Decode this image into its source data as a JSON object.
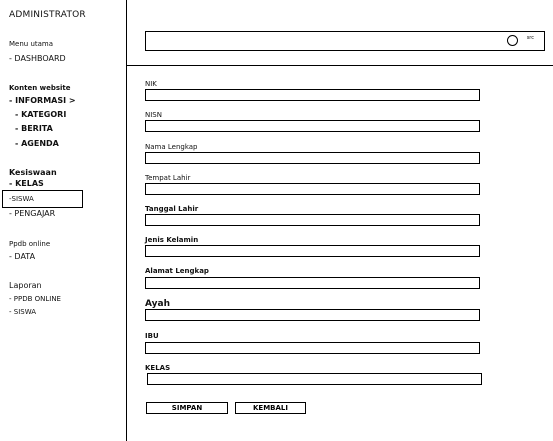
{
  "sidebar": {
    "title": "ADMINISTRATOR",
    "menu_utama": "Menu utama",
    "dashboard": "- DASHBOARD",
    "konten_website": "Konten website",
    "informasi": "- INFORMASI >",
    "kategori": "- KATEGORI",
    "berita": "- BERITA",
    "agenda": "- AGENDA",
    "kesiswaan": "Kesiswaan",
    "kelas": "- KELAS",
    "siswa": "-SISWA",
    "pengajar": "- PENGAJAR",
    "ppdb_online": "Ppdb online",
    "data": "- DATA",
    "laporan": "Laporan",
    "ppdb_report": "- PPDB ONLINE",
    "siswa_report": "- SISWA"
  },
  "search": {
    "label": "src"
  },
  "form": {
    "nik": "NIK",
    "nisn": "NISN",
    "nama_lengkap": "Nama Lengkap",
    "tempat_lahir": "Tempat Lahir",
    "tanggal_lahir": "Tanggal Lahir",
    "jenis_kelamin": "Jenis Kelamin",
    "alamat_lengkap": "Alamat Lengkap",
    "ayah": "Ayah",
    "ibu": "IBU",
    "kelas": "KELAS"
  },
  "buttons": {
    "simpan": "SIMPAN",
    "kembali": "KEMBALI"
  }
}
